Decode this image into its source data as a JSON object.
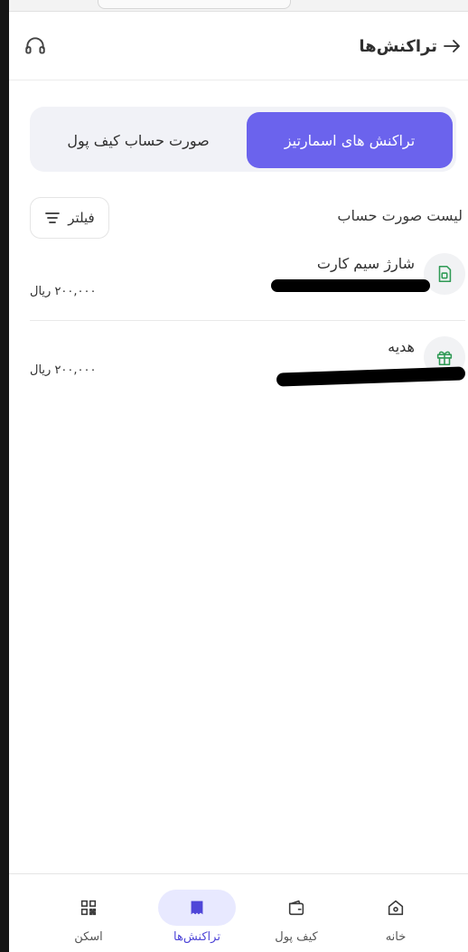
{
  "header": {
    "title": "تراکنش‌ها"
  },
  "tabs": {
    "active_label": "تراکنش های اسمارتیز",
    "inactive_label": "صورت حساب کیف پول"
  },
  "list": {
    "section_title": "لیست صورت حساب",
    "filter_label": "فیلتر",
    "items": [
      {
        "title": "شارژ سیم کارت",
        "amount": "۲۰۰,۰۰۰ ریال",
        "icon": "sim-card-icon"
      },
      {
        "title": "هدیه",
        "amount": "۲۰۰,۰۰۰ ریال",
        "icon": "gift-icon"
      }
    ]
  },
  "bottom_nav": {
    "items": [
      {
        "label": "خانه",
        "icon": "home-icon",
        "active": false
      },
      {
        "label": "کیف پول",
        "icon": "wallet-icon",
        "active": false
      },
      {
        "label": "تراکنش‌ها",
        "icon": "receipt-icon",
        "active": true
      },
      {
        "label": "اسکن",
        "icon": "qr-scan-icon",
        "active": false
      }
    ]
  },
  "colors": {
    "accent": "#6b63ed",
    "accent_soft": "#e8e9ff",
    "background": "#ffffff"
  }
}
